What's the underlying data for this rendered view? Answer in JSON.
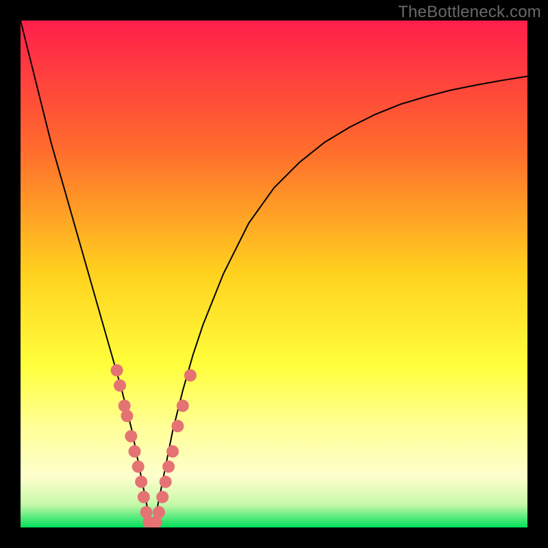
{
  "watermark": "TheBottleneck.com",
  "chart_data": {
    "type": "line",
    "title": "",
    "xlabel": "",
    "ylabel": "",
    "xlim": [
      0,
      100
    ],
    "ylim": [
      0,
      100
    ],
    "grid": false,
    "legend": false,
    "background_gradient": {
      "stops": [
        {
          "offset": 0.0,
          "color": "#ff1f4b"
        },
        {
          "offset": 0.25,
          "color": "#ff6a2d"
        },
        {
          "offset": 0.5,
          "color": "#ffd21e"
        },
        {
          "offset": 0.68,
          "color": "#ffff3c"
        },
        {
          "offset": 0.8,
          "color": "#ffff96"
        },
        {
          "offset": 0.9,
          "color": "#feffcd"
        },
        {
          "offset": 0.955,
          "color": "#c7f8a8"
        },
        {
          "offset": 1.0,
          "color": "#00e05a"
        }
      ]
    },
    "series": [
      {
        "name": "curve",
        "stroke": "#000000",
        "stroke_width": 2,
        "x": [
          0,
          2,
          4,
          6,
          8,
          10,
          12,
          14,
          16,
          18,
          20,
          21,
          22,
          23,
          24,
          25,
          26,
          27,
          28,
          29,
          30,
          32,
          34,
          36,
          40,
          45,
          50,
          55,
          60,
          65,
          70,
          75,
          80,
          85,
          90,
          95,
          100
        ],
        "y": [
          100,
          92,
          84,
          76,
          69,
          62,
          55,
          48,
          41,
          34,
          27,
          23,
          19,
          14,
          9,
          4,
          0,
          4,
          9,
          14,
          19,
          27,
          34,
          40,
          50,
          60,
          67,
          72,
          76,
          79,
          81.5,
          83.5,
          85,
          86.3,
          87.3,
          88.2,
          89
        ]
      }
    ],
    "scatter": {
      "name": "highlight-points",
      "color": "#e57373",
      "radius": 9,
      "points": [
        {
          "x": 19.0,
          "y": 31
        },
        {
          "x": 19.6,
          "y": 28
        },
        {
          "x": 20.5,
          "y": 24
        },
        {
          "x": 21.0,
          "y": 22
        },
        {
          "x": 21.8,
          "y": 18
        },
        {
          "x": 22.5,
          "y": 15
        },
        {
          "x": 23.2,
          "y": 12
        },
        {
          "x": 23.8,
          "y": 9
        },
        {
          "x": 24.3,
          "y": 6
        },
        {
          "x": 24.8,
          "y": 3
        },
        {
          "x": 25.3,
          "y": 1
        },
        {
          "x": 26.0,
          "y": 0
        },
        {
          "x": 26.7,
          "y": 1
        },
        {
          "x": 27.3,
          "y": 3
        },
        {
          "x": 28.0,
          "y": 6
        },
        {
          "x": 28.6,
          "y": 9
        },
        {
          "x": 29.2,
          "y": 12
        },
        {
          "x": 30.0,
          "y": 15
        },
        {
          "x": 31.0,
          "y": 20
        },
        {
          "x": 32.0,
          "y": 24
        },
        {
          "x": 33.5,
          "y": 30
        }
      ]
    }
  }
}
